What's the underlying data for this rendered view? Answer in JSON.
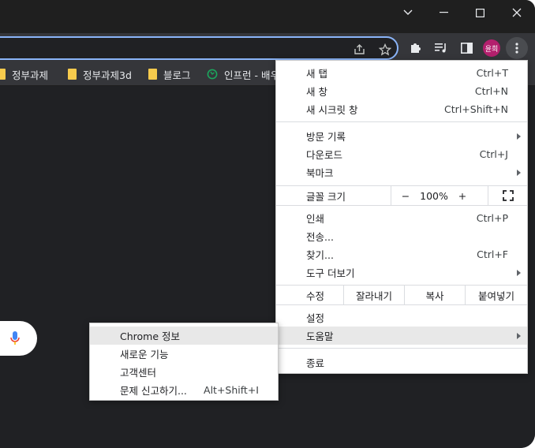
{
  "window_controls": {
    "tab_search_icon": "chevron-down",
    "minimize_icon": "minimize",
    "maximize_icon": "maximize",
    "close_icon": "close"
  },
  "toolbar": {
    "avatar_text": "윤희",
    "share_icon": "share",
    "star_icon": "star",
    "extensions_icon": "puzzle",
    "media_icon": "media-queue",
    "sidepanel_icon": "side-panel",
    "menu_icon": "three-dots-vertical"
  },
  "bookmarks": [
    {
      "label": "정부과제",
      "icon": "folder"
    },
    {
      "label": "정부과제3d",
      "icon": "folder"
    },
    {
      "label": "블로그",
      "icon": "folder"
    },
    {
      "label": "인프런 - 배우",
      "icon": "inflearn"
    }
  ],
  "menu": {
    "new_tab": {
      "label": "새 탭",
      "shortcut": "Ctrl+T"
    },
    "new_window": {
      "label": "새 창",
      "shortcut": "Ctrl+N"
    },
    "incognito": {
      "label": "새 시크릿 창",
      "shortcut": "Ctrl+Shift+N"
    },
    "history": {
      "label": "방문 기록"
    },
    "downloads": {
      "label": "다운로드",
      "shortcut": "Ctrl+J"
    },
    "bookmarks": {
      "label": "북마크"
    },
    "zoom": {
      "label": "글꼴 크기",
      "minus": "−",
      "value": "100%",
      "plus": "+"
    },
    "print": {
      "label": "인쇄",
      "shortcut": "Ctrl+P"
    },
    "cast": {
      "label": "전송..."
    },
    "find": {
      "label": "찾기...",
      "shortcut": "Ctrl+F"
    },
    "more_tools": {
      "label": "도구 더보기"
    },
    "edit": {
      "label": "수정",
      "cut": "잘라내기",
      "copy": "복사",
      "paste": "붙여넣기"
    },
    "settings": {
      "label": "설정"
    },
    "help": {
      "label": "도움말"
    },
    "exit": {
      "label": "종료"
    }
  },
  "help_submenu": {
    "about": "Chrome 정보",
    "whats_new": "새로운 기능",
    "help_center": "고객센터",
    "report": {
      "label": "문제 신고하기...",
      "shortcut": "Alt+Shift+I"
    }
  },
  "colors": {
    "frame": "#1f1f1f",
    "toolbar": "#35363a",
    "content": "#202124",
    "omnibox_focus": "#8ab4f8",
    "avatar": "#b3206d",
    "folder": "#f7cb4d",
    "menu_highlight": "#e8e8e8"
  }
}
